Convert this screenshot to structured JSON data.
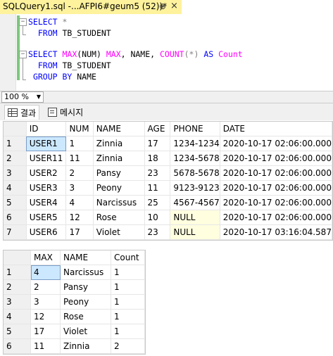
{
  "tab": {
    "title": "SQLQuery1.sql -...AFPI6#geum5 (52))*",
    "pin": "⊕",
    "close": "×"
  },
  "editor": {
    "q1_l1_kw": "SELECT",
    "q1_l1_rest": " *",
    "q1_l2_kw": "FROM",
    "q1_l2_rest": " TB_STUDENT",
    "q2_l1_kw1": "SELECT",
    "q2_l1_fn1": "MAX",
    "q2_l1_p1": "(NUM) ",
    "q2_l1_fn1b": "MAX",
    "q2_l1_p2": ", NAME, ",
    "q2_l1_fn2": "COUNT",
    "q2_l1_p3": "(*) ",
    "q2_l1_kw2": "AS",
    "q2_l1_fn3": "Count",
    "q2_l2_kw": "FROM",
    "q2_l2_rest": " TB_STUDENT",
    "q2_l3_kw": "GROUP BY",
    "q2_l3_rest": " NAME"
  },
  "zoom": {
    "value": "100 %"
  },
  "result_tabs": {
    "results": "결과",
    "messages": "메시지"
  },
  "grid1": {
    "columns": [
      "ID",
      "NUM",
      "NAME",
      "AGE",
      "PHONE",
      "DATE"
    ],
    "rows": [
      [
        "1",
        "USER1",
        "1",
        "Zinnia",
        "17",
        "1234-1234",
        "2020-10-17 02:06:00.000"
      ],
      [
        "2",
        "USER11",
        "11",
        "Zinnia",
        "18",
        "1234-5678",
        "2020-10-17 02:06:00.000"
      ],
      [
        "3",
        "USER2",
        "2",
        "Pansy",
        "23",
        "5678-5678",
        "2020-10-17 02:06:00.000"
      ],
      [
        "4",
        "USER3",
        "3",
        "Peony",
        "11",
        "9123-9123",
        "2020-10-17 02:06:00.000"
      ],
      [
        "5",
        "USER4",
        "4",
        "Narcissus",
        "25",
        "4567-4567",
        "2020-10-17 02:06:00.000"
      ],
      [
        "6",
        "USER5",
        "12",
        "Rose",
        "10",
        "NULL",
        "2020-10-17 02:06:00.000"
      ],
      [
        "7",
        "USER6",
        "17",
        "Violet",
        "23",
        "NULL",
        "2020-10-17 03:16:04.587"
      ]
    ]
  },
  "grid2": {
    "columns": [
      "MAX",
      "NAME",
      "Count"
    ],
    "rows": [
      [
        "1",
        "4",
        "Narcissus",
        "1"
      ],
      [
        "2",
        "2",
        "Pansy",
        "1"
      ],
      [
        "3",
        "3",
        "Peony",
        "1"
      ],
      [
        "4",
        "12",
        "Rose",
        "1"
      ],
      [
        "5",
        "17",
        "Violet",
        "1"
      ],
      [
        "6",
        "11",
        "Zinnia",
        "2"
      ]
    ]
  }
}
